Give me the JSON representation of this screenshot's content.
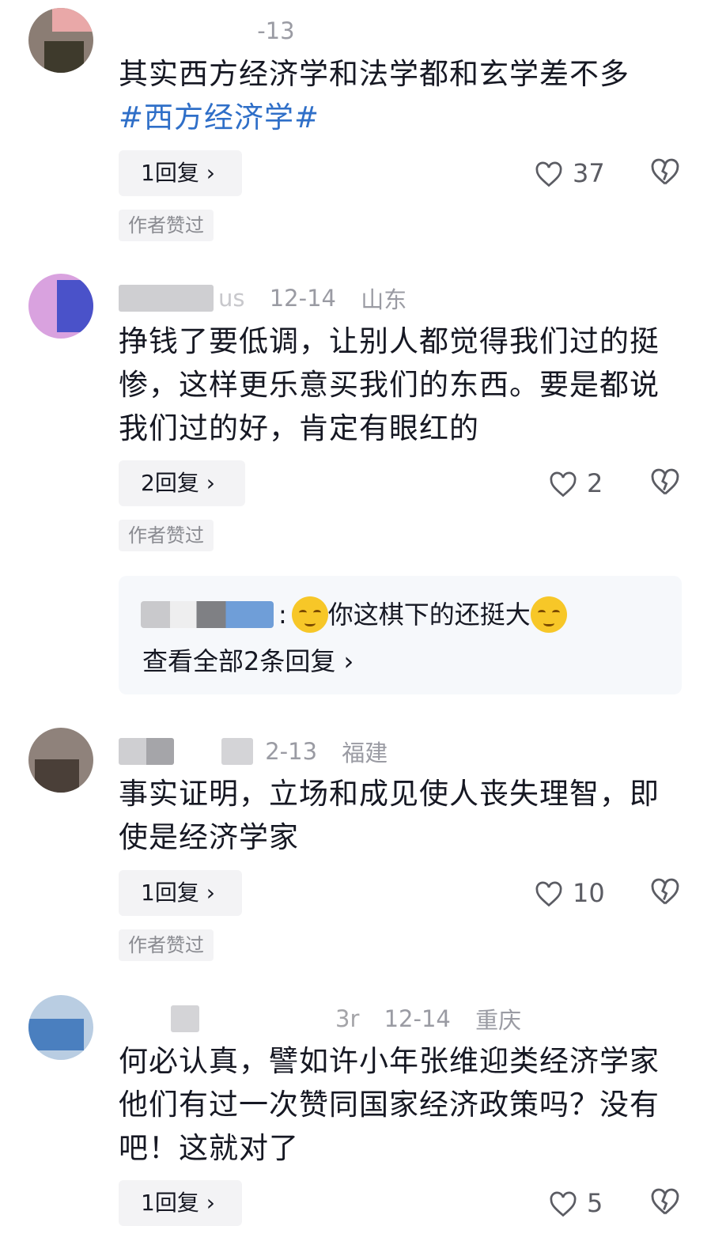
{
  "comments": [
    {
      "date": "-13",
      "location": "",
      "text": "其实西方经济学和法学都和玄学差不多",
      "hashtag": "#西方经济学#",
      "replies_label": "1回复 ›",
      "likes": "37",
      "badge": "作者赞过"
    },
    {
      "user_tail": "us",
      "date": "12-14",
      "location": "山东",
      "text": "挣钱了要低调，让别人都觉得我们过的挺惨，这样更乐意买我们的东西。要是都说我们过的好，肯定有眼红的",
      "replies_label": "2回复 ›",
      "likes": "2",
      "badge": "作者赞过",
      "sub_reply": {
        "separator": ":",
        "text": "你这棋下的还挺大",
        "view_all": "查看全部2条回复 ›"
      }
    },
    {
      "date": "2-13",
      "location": "福建",
      "text": "事实证明，立场和成见使人丧失理智，即使是经济学家",
      "replies_label": "1回复 ›",
      "likes": "10",
      "badge": "作者赞过"
    },
    {
      "user_tail": "3r",
      "date": "12-14",
      "location": "重庆",
      "text": "何必认真，譬如许小年张维迎类经济学家他们有过一次赞同国家经济政策吗？没有吧！这就对了",
      "replies_label": "1回复 ›",
      "likes": "5"
    }
  ],
  "icons": {
    "like": "heart-outline-icon",
    "dislike": "broken-heart-icon",
    "emoji": "relieved-face-emoji"
  },
  "colors": {
    "hashtag": "#2f6fc8",
    "meta": "#9a9ba3",
    "reply_bg": "#f3f3f5"
  }
}
